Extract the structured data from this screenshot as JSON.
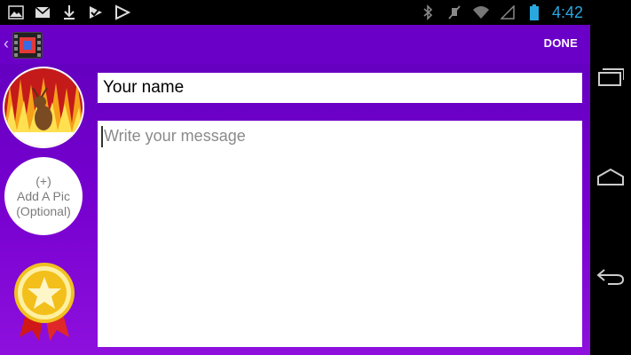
{
  "status_bar": {
    "time": "4:42",
    "left_icons": [
      "image-icon",
      "mail-icon",
      "download-icon",
      "task-icon",
      "play-store-icon"
    ],
    "right_icons": [
      "bluetooth-icon",
      "mute-icon",
      "wifi-icon",
      "signal-icon",
      "battery-icon"
    ]
  },
  "app_bar": {
    "done_label": "DONE"
  },
  "left_panel": {
    "add_pic_plus": "(+)",
    "add_pic_line1": "Add A Pic",
    "add_pic_line2": "(Optional)"
  },
  "form": {
    "name_value": "Your name",
    "message_placeholder": "Write your message"
  },
  "colors": {
    "accent_purple": "#6a00c8",
    "time_blue": "#29a8e0"
  }
}
